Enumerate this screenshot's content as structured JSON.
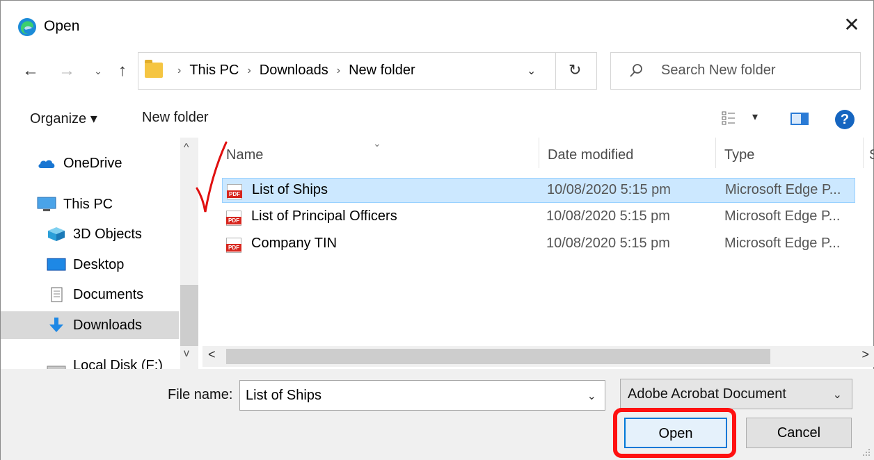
{
  "window": {
    "title": "Open",
    "close_glyph": "✕"
  },
  "nav": {
    "back_glyph": "←",
    "forward_glyph": "→",
    "recent_glyph": "⌄",
    "up_glyph": "↑",
    "breadcrumbs": [
      "This PC",
      "Downloads",
      "New folder"
    ],
    "crumb_sep": "›",
    "address_dropdown_glyph": "⌄",
    "refresh_glyph": "↻",
    "search_placeholder": "Search New folder"
  },
  "toolbar": {
    "organize_label": "Organize ▾",
    "new_folder_label": "New folder",
    "view_dropdown_glyph": "▾",
    "help_glyph": "?"
  },
  "sidebar": {
    "items": [
      {
        "label": "OneDrive",
        "icon": "cloud-icon"
      },
      {
        "label": "This PC",
        "icon": "computer-icon"
      },
      {
        "label": "3D Objects",
        "icon": "cube-icon"
      },
      {
        "label": "Desktop",
        "icon": "desktop-icon"
      },
      {
        "label": "Documents",
        "icon": "document-icon"
      },
      {
        "label": "Downloads",
        "icon": "download-arrow-icon",
        "selected": true
      },
      {
        "label": "Local Disk (F:)",
        "icon": "drive-icon"
      }
    ],
    "scroll_up_glyph": "^",
    "scroll_down_glyph": "v"
  },
  "filelist": {
    "columns": [
      "Name",
      "Date modified",
      "Type",
      "S"
    ],
    "sort_caret": "⌄",
    "rows": [
      {
        "name": "List of Ships",
        "date": "10/08/2020 5:15 pm",
        "type": "Microsoft Edge P...",
        "selected": true
      },
      {
        "name": "List of Principal Officers",
        "date": "10/08/2020 5:15 pm",
        "type": "Microsoft Edge P..."
      },
      {
        "name": "Company TIN",
        "date": "10/08/2020 5:15 pm",
        "type": "Microsoft Edge P..."
      }
    ],
    "hscroll_left_glyph": "<",
    "hscroll_right_glyph": ">"
  },
  "footer": {
    "file_name_label": "File name:",
    "file_name_value": "List of Ships",
    "file_name_dropdown_glyph": "⌄",
    "file_type_value": "Adobe Acrobat Document",
    "file_type_dropdown_glyph": "⌄",
    "open_label": "Open",
    "cancel_label": "Cancel"
  },
  "colors": {
    "selection_bg": "#cce8ff",
    "annotation_red": "#ff1111",
    "accent_blue": "#0078d7"
  }
}
